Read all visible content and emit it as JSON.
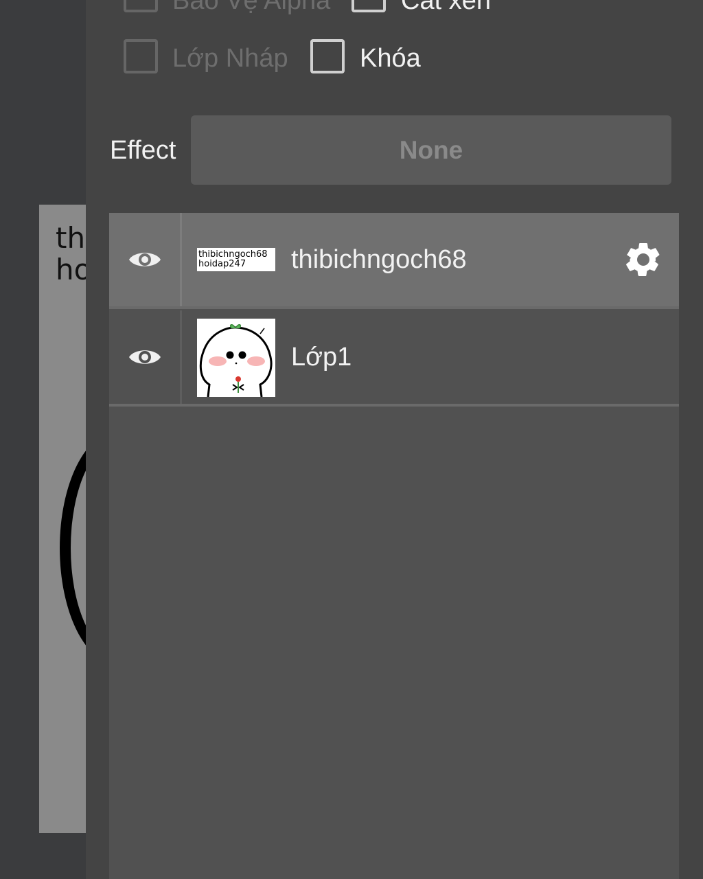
{
  "canvas": {
    "text": "th\nho"
  },
  "panel": {
    "checkboxes": [
      {
        "label": "Bảo Vệ Alpha"
      },
      {
        "label": "Cắt xén"
      },
      {
        "label": "Lớp Nháp"
      },
      {
        "label": "Khóa"
      }
    ],
    "effect": {
      "label": "Effect",
      "value": "None"
    }
  },
  "layers": [
    {
      "name": "thibichngoch68",
      "thumb_text": "thibichngoch68\nhoidap247",
      "selected": true
    },
    {
      "name": "Lớp1",
      "selected": false
    }
  ],
  "colors": {
    "panel_bg": "#444444",
    "list_bg": "#515151",
    "selected_row": "#707070"
  }
}
